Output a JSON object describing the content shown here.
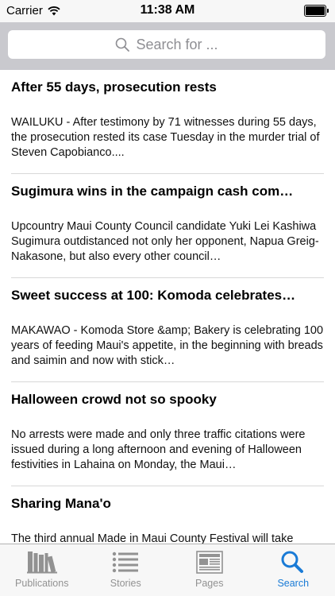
{
  "status_bar": {
    "carrier": "Carrier",
    "time": "11:38 AM",
    "battery_level": 1.0
  },
  "search": {
    "placeholder": "Search for ...",
    "icon": "search-icon"
  },
  "articles": [
    {
      "title": "After 55 days, prosecution rests",
      "summary": "WAILUKU - After testimony by 71 witnesses during 55 days, the prosecution rested its case Tuesday in the murder trial of Steven Capobianco...."
    },
    {
      "title": "Sugimura wins in the campaign cash com…",
      "summary": "Upcountry Maui County Council candidate Yuki Lei Kashiwa Sugimura outdistanced not only her opponent, Napua Greig-Nakasone, but also every other council…"
    },
    {
      "title": "Sweet success at 100: Komoda celebrates…",
      "summary": "MAKAWAO - Komoda Store &amp; Bakery is celebrating 100 years of feeding Maui's appetite, in the beginning with breads and saimin and now with stick…"
    },
    {
      "title": "Halloween crowd not so spooky",
      "summary": "No arrests were made and only three traffic citations were issued during a long afternoon and evening of Halloween festivities in Lahaina on Monday, the Maui…"
    },
    {
      "title": "Sharing Mana'o",
      "summary": "The third annual Made in Maui County Festival will take"
    }
  ],
  "tabs": [
    {
      "label": "Publications",
      "icon": "books-icon",
      "active": false
    },
    {
      "label": "Stories",
      "icon": "list-icon",
      "active": false
    },
    {
      "label": "Pages",
      "icon": "newspaper-icon",
      "active": false
    },
    {
      "label": "Search",
      "icon": "search-icon",
      "active": true
    }
  ],
  "colors": {
    "accent": "#1a7bd6",
    "tab_inactive": "#929292",
    "search_header_bg": "#c9c9ce"
  }
}
